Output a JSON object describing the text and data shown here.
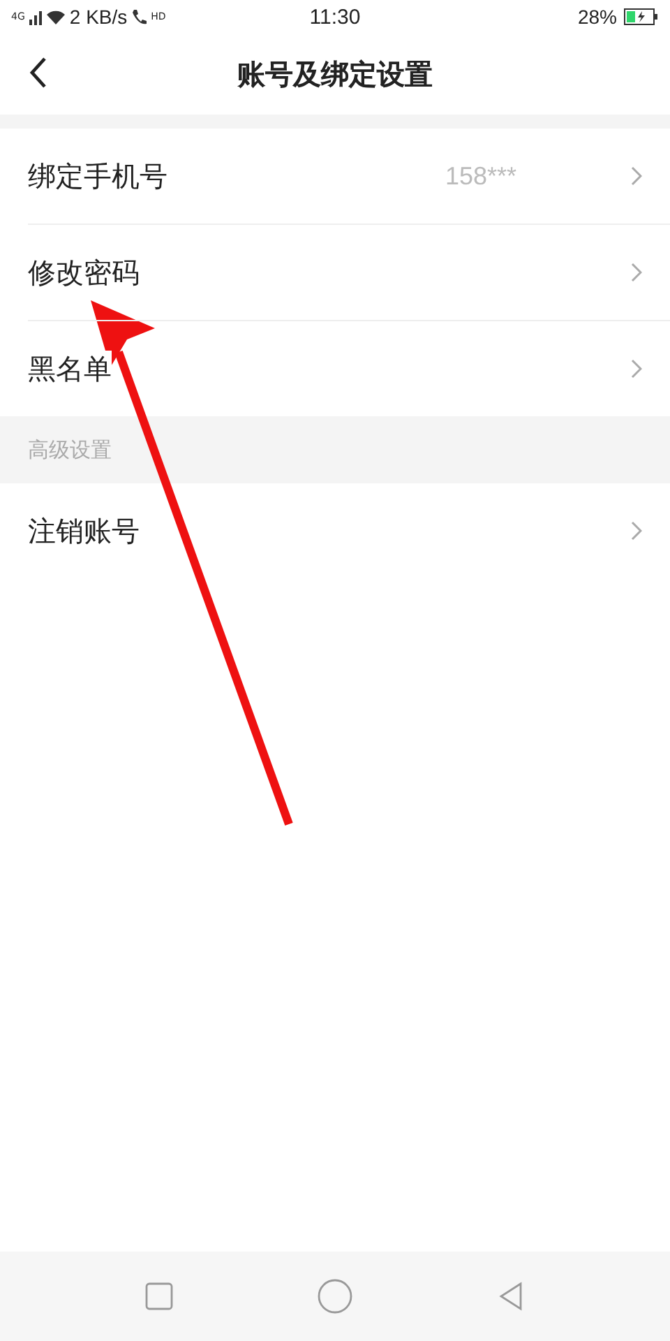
{
  "status_bar": {
    "network": "4G",
    "speed": "2 KB/s",
    "call_badge": "HD",
    "time": "11:30",
    "battery": "28%"
  },
  "header": {
    "title": "账号及绑定设置"
  },
  "sections": [
    {
      "items": [
        {
          "label": "绑定手机号",
          "value": "158***"
        },
        {
          "label": "修改密码"
        },
        {
          "label": "黑名单"
        }
      ]
    },
    {
      "title": "高级设置",
      "items": [
        {
          "label": "注销账号"
        }
      ]
    }
  ],
  "annotations": [
    {
      "kind": "arrow"
    }
  ],
  "nav_bar": {
    "buttons": [
      {
        "kind": "recents"
      },
      {
        "kind": "home"
      },
      {
        "kind": "back"
      }
    ]
  }
}
